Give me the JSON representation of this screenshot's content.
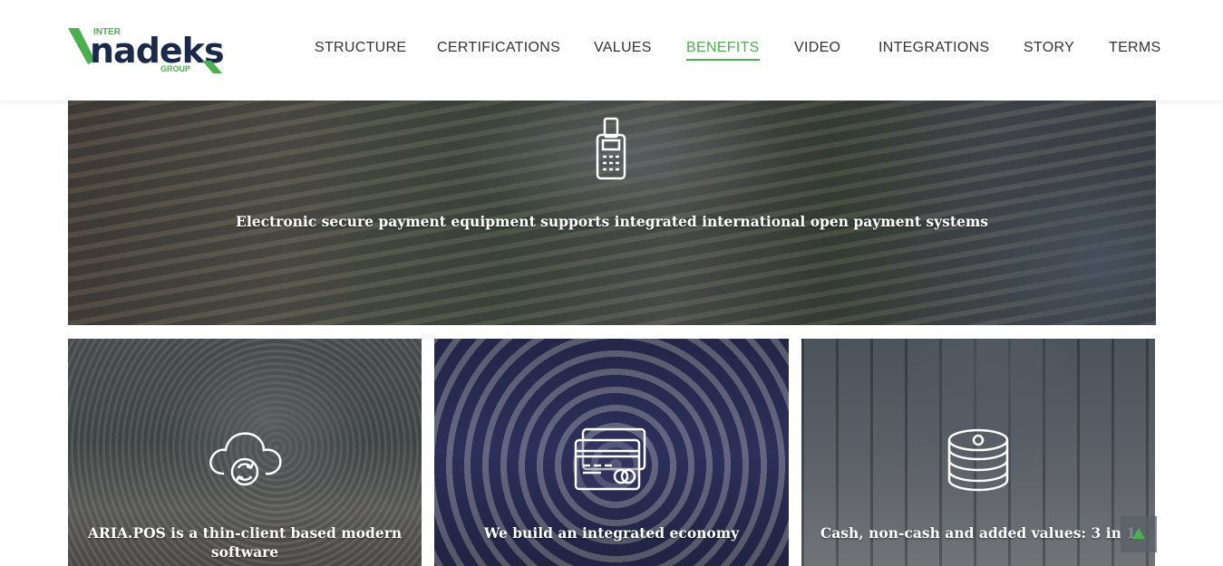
{
  "brand": {
    "logo_prefix": "INTER",
    "logo_name": "nadeks",
    "logo_suffix": "GROUP",
    "accent_color": "#4caf50",
    "navy_color": "#1b2a4a"
  },
  "nav": {
    "items": [
      {
        "label": "STRUCTURE"
      },
      {
        "label": "CERTIFICATIONS"
      },
      {
        "label": "VALUES"
      },
      {
        "label": "BENEFITS",
        "active": true
      },
      {
        "label": "VIDEO"
      },
      {
        "label": "INTEGRATIONS"
      },
      {
        "label": "STORY"
      },
      {
        "label": "TERMS"
      }
    ]
  },
  "hero": {
    "icon": "pos-terminal-icon",
    "caption": "Electronic secure payment equipment supports integrated international open payment systems"
  },
  "cards": [
    {
      "icon": "cloud-sync-icon",
      "caption": "ARIA.POS is a thin-client based modern software"
    },
    {
      "icon": "credit-cards-icon",
      "caption": "We build an integrated economy"
    },
    {
      "icon": "coin-stack-icon",
      "caption": "Cash, non-cash and added values: 3 in 1"
    }
  ],
  "scroll_top": {
    "icon": "arrow-up-icon"
  }
}
